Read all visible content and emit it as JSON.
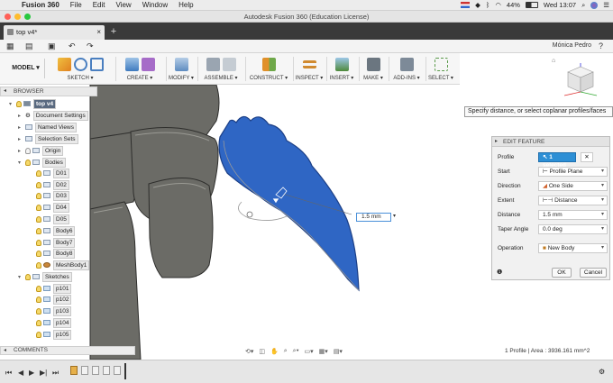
{
  "menubar": {
    "app": "Fusion 360",
    "items": [
      "File",
      "Edit",
      "View",
      "Window",
      "Help"
    ],
    "battery": "44%",
    "clock": "Wed 13:07"
  },
  "window": {
    "title": "Autodesk Fusion 360 (Education License)"
  },
  "tab": {
    "title": "top v4*"
  },
  "user": {
    "name": "Mónica Pedro"
  },
  "ribbon": {
    "workspace": "MODEL",
    "groups": [
      "SKETCH",
      "CREATE",
      "MODIFY",
      "ASSEMBLE",
      "CONSTRUCT",
      "INSPECT",
      "INSERT",
      "MAKE",
      "ADD-INS",
      "SELECT"
    ]
  },
  "tooltip": "Specify distance, or select coplanar profiles/faces",
  "browser": {
    "title": "BROWSER",
    "root": "top v4",
    "items": {
      "document_settings": "Document Settings",
      "named_views": "Named Views",
      "selection_sets": "Selection Sets",
      "origin": "Origin",
      "bodies": "Bodies",
      "d01": "D01",
      "d02": "D02",
      "d03": "D03",
      "d04": "D04",
      "d05": "D05",
      "body6": "Body6",
      "body7": "Body7",
      "body8": "Body8",
      "meshbody1": "MeshBody1",
      "sketches": "Sketches",
      "p101": "p101",
      "p102": "p102",
      "p103": "p103",
      "p104": "p104",
      "p105": "p105"
    }
  },
  "edit_feature": {
    "title": "EDIT FEATURE",
    "profile_label": "Profile",
    "profile_value": "1 selected",
    "start_label": "Start",
    "start_value": "Profile Plane",
    "direction_label": "Direction",
    "direction_value": "One Side",
    "extent_label": "Extent",
    "extent_value": "Distance",
    "distance_label": "Distance",
    "distance_value": "1.5 mm",
    "taper_label": "Taper Angle",
    "taper_value": "0.0 deg",
    "operation_label": "Operation",
    "operation_value": "New Body",
    "ok": "OK",
    "cancel": "Cancel"
  },
  "distance_input": {
    "value": "1.5 mm"
  },
  "comments": {
    "title": "COMMENTS"
  },
  "status": "1 Profile | Area : 3936.161 mm^2",
  "colors": {
    "profile_blue": "#2f66c4",
    "selection_blue": "#2d8fd5",
    "body_grey": "#6b6b66"
  }
}
